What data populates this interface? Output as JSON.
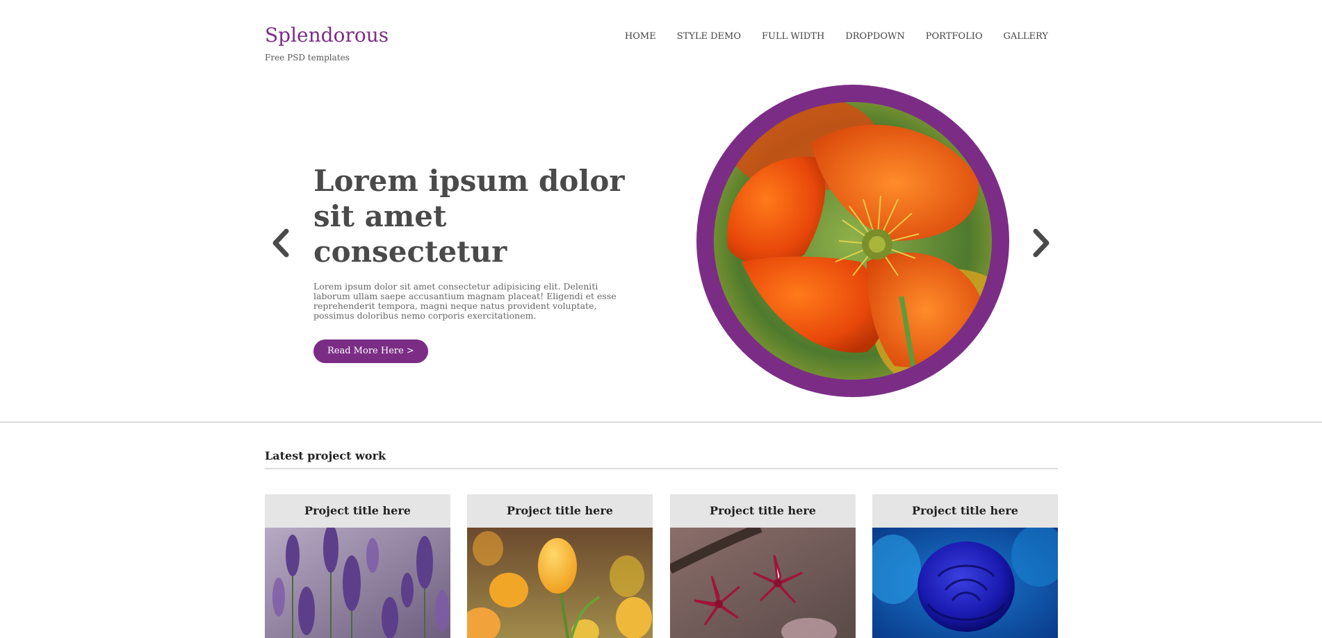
{
  "site": {
    "title": "Splendorous",
    "tagline": "Free PSD templates"
  },
  "nav": {
    "items": [
      "HOME",
      "STYLE DEMO",
      "FULL WIDTH",
      "DROPDOWN",
      "PORTFOLIO",
      "GALLERY"
    ]
  },
  "hero": {
    "heading_line1": "Lorem ipsum dolor",
    "heading_line2": "sit amet consectetur",
    "body": "Lorem ipsum dolor sit amet consectetur adipisicing elit. Deleniti laborum ullam saepe accusantium magnam placeat! Eligendi et esse reprehenderit tempora, magni neque natus provident voluptate, possimus doloribus nemo corporis exercitationem.",
    "button_label": "Read More Here >",
    "prev_icon": "chevron-left-icon",
    "next_icon": "chevron-right-icon",
    "image": "orange-poppy-photo"
  },
  "projects": {
    "section_title": "Latest project work",
    "cards": [
      {
        "title": "Project title here",
        "image": "lavender-photo"
      },
      {
        "title": "Project title here",
        "image": "yellow-tulips-photo"
      },
      {
        "title": "Project title here",
        "image": "white-pink-flowers-photo"
      },
      {
        "title": "Project title here",
        "image": "blue-rose-photo"
      }
    ]
  },
  "colors": {
    "brand": "#7b2d86",
    "text_dark": "#4a4a4a",
    "card_header_bg": "#e5e5e5",
    "divider": "#dcdcdc"
  }
}
